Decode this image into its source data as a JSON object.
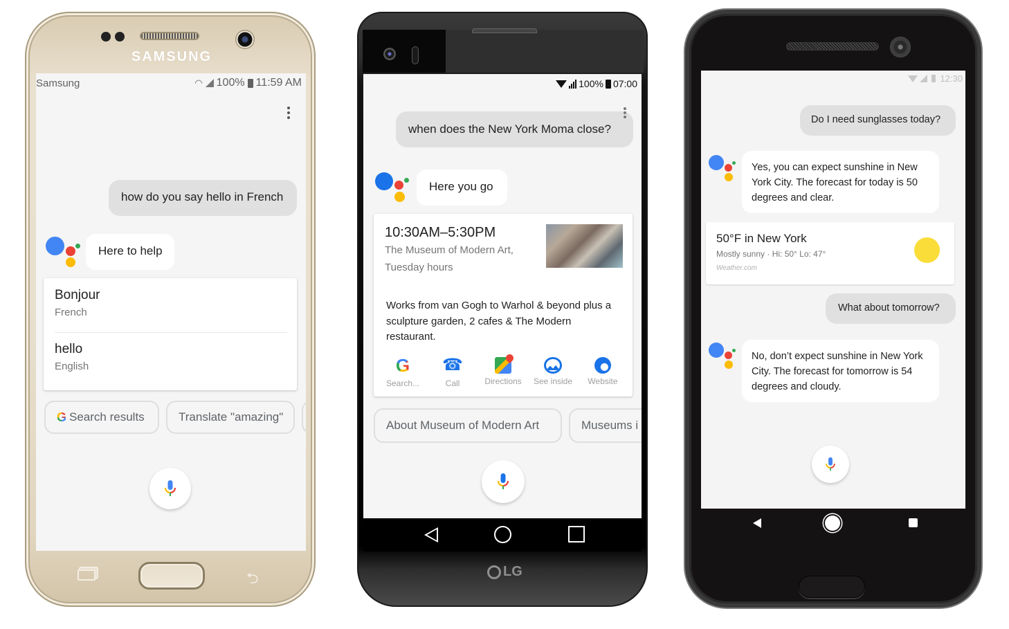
{
  "phones": {
    "samsung": {
      "brand": "SAMSUNG",
      "status_bar": {
        "carrier": "Samsung",
        "battery": "100%",
        "time": "11:59 AM"
      },
      "user_query": "how do you say hello in French",
      "assistant_reply": "Here to help",
      "translation_card": [
        {
          "word": "Bonjour",
          "language": "French"
        },
        {
          "word": "hello",
          "language": "English"
        }
      ],
      "suggestion_chips": [
        "Search results",
        "Translate \"amazing\""
      ]
    },
    "lg": {
      "brand": "LG",
      "status_bar": {
        "battery": "100%",
        "time": "07:00"
      },
      "user_query": "when does the New York Moma close?",
      "assistant_reply": "Here you go",
      "place_card": {
        "hours": "10:30AM–5:30PM",
        "place_line1": "The Museum of Modern Art,",
        "place_line2": "Tuesday hours",
        "description": "Works from van Gogh to Warhol & beyond plus a sculpture garden, 2 cafes & The Modern restaurant.",
        "actions": [
          "Search...",
          "Call",
          "Directions",
          "See inside",
          "Website"
        ]
      },
      "suggestion_chips": [
        "About Museum of Modern Art",
        "Museums i"
      ]
    },
    "pixel": {
      "status_bar": {
        "time": "12:30"
      },
      "user_query_1": "Do I need sunglasses today?",
      "assistant_reply_1": "Yes, you can expect sunshine in New York City. The forecast for today is 50 degrees and clear.",
      "weather_card": {
        "title": "50°F in New York",
        "detail": "Mostly sunny · Hi: 50° Lo: 47°",
        "source": "Weather.com"
      },
      "user_query_2": "What about tomorrow?",
      "assistant_reply_2": "No, don’t expect sunshine in New York City. The forecast for tomorrow is 54 degrees and cloudy."
    }
  },
  "colors": {
    "google_blue": "#4285f4",
    "google_red": "#ea4335",
    "google_yellow": "#fbbc05",
    "google_green": "#34a853",
    "sun": "#fbdd3a"
  }
}
